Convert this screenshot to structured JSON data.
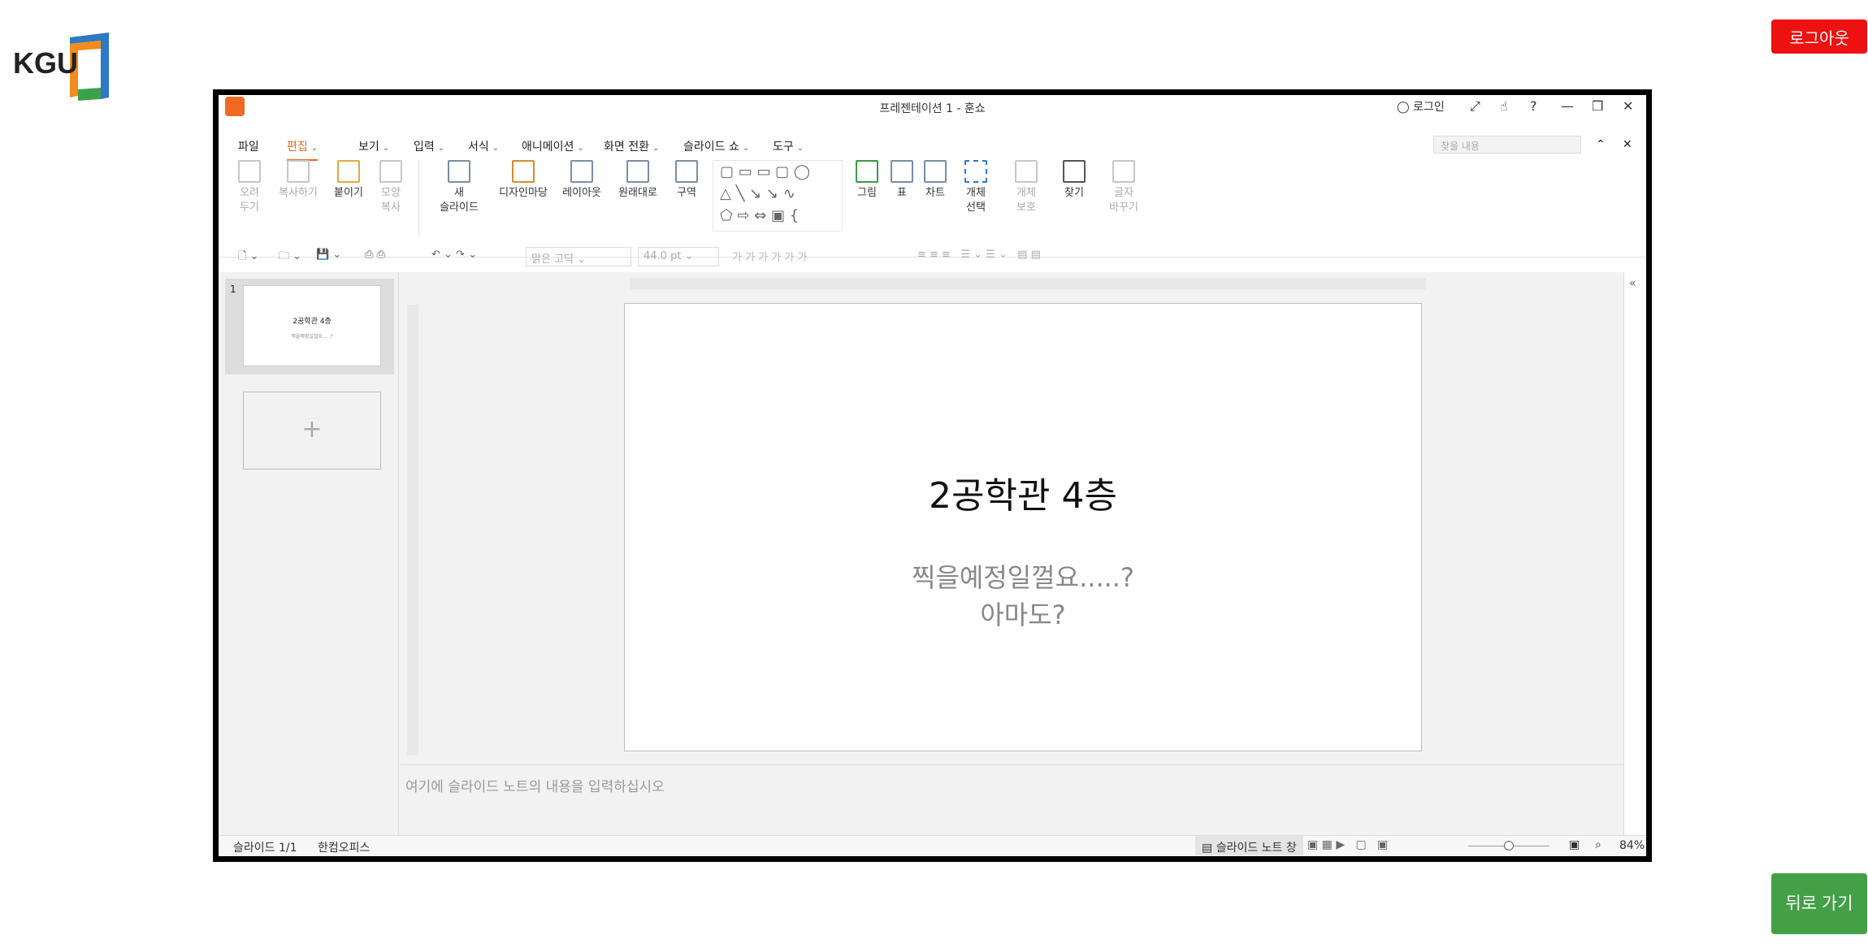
{
  "logo_text": "KGU",
  "logout_label": "로그아웃",
  "back_label": "뒤로 가기",
  "window": {
    "title": "프레젠테이션 1 - 훈쇼",
    "login_label": "로그인",
    "search_placeholder": "찾을 내용"
  },
  "menu": [
    "파일",
    "편집",
    "보기",
    "입력",
    "서식",
    "애니메이션",
    "화면 전환",
    "슬라이드 쇼",
    "도구"
  ],
  "ribbon": [
    {
      "label": "오려\n두기",
      "icon": "scissors-icon",
      "enabled": false
    },
    {
      "label": "복사하기",
      "icon": "copy-icon",
      "enabled": false
    },
    {
      "label": "붙이기",
      "icon": "paste-icon",
      "enabled": true
    },
    {
      "label": "모양\n복사",
      "icon": "format-painter-icon",
      "enabled": false
    },
    {
      "label": "새\n슬라이드",
      "icon": "new-slide-icon",
      "enabled": true
    },
    {
      "label": "디자인마당",
      "icon": "design-icon",
      "enabled": true
    },
    {
      "label": "레이아웃",
      "icon": "layout-icon",
      "enabled": true
    },
    {
      "label": "원래대로",
      "icon": "reset-icon",
      "enabled": true
    },
    {
      "label": "구역",
      "icon": "section-icon",
      "enabled": true
    },
    {
      "label": "그림",
      "icon": "picture-icon",
      "enabled": true
    },
    {
      "label": "표",
      "icon": "table-icon",
      "enabled": true
    },
    {
      "label": "차트",
      "icon": "chart-icon",
      "enabled": true
    },
    {
      "label": "개체\n선택",
      "icon": "select-object-icon",
      "enabled": true
    },
    {
      "label": "개체\n보호",
      "icon": "protect-object-icon",
      "enabled": false
    },
    {
      "label": "찾기",
      "icon": "find-icon",
      "enabled": true
    },
    {
      "label": "글자\n바꾸기",
      "icon": "replace-icon",
      "enabled": false
    }
  ],
  "toolbar": {
    "font": "맑은 고딕",
    "size": "44.0",
    "unit": "pt"
  },
  "slide": {
    "number": "1",
    "title": "2공학관 4층",
    "subtitle_line1": "찍을예정일껄요.....?",
    "subtitle_line2": "아마도?"
  },
  "notes_placeholder": "여기에 슬라이드 노트의 내용을 입력하십시오",
  "status": {
    "slide": "슬라이드 1/1",
    "app": "한컴오피스",
    "notes_pane": "슬라이드 노트 창",
    "zoom": "84%"
  }
}
